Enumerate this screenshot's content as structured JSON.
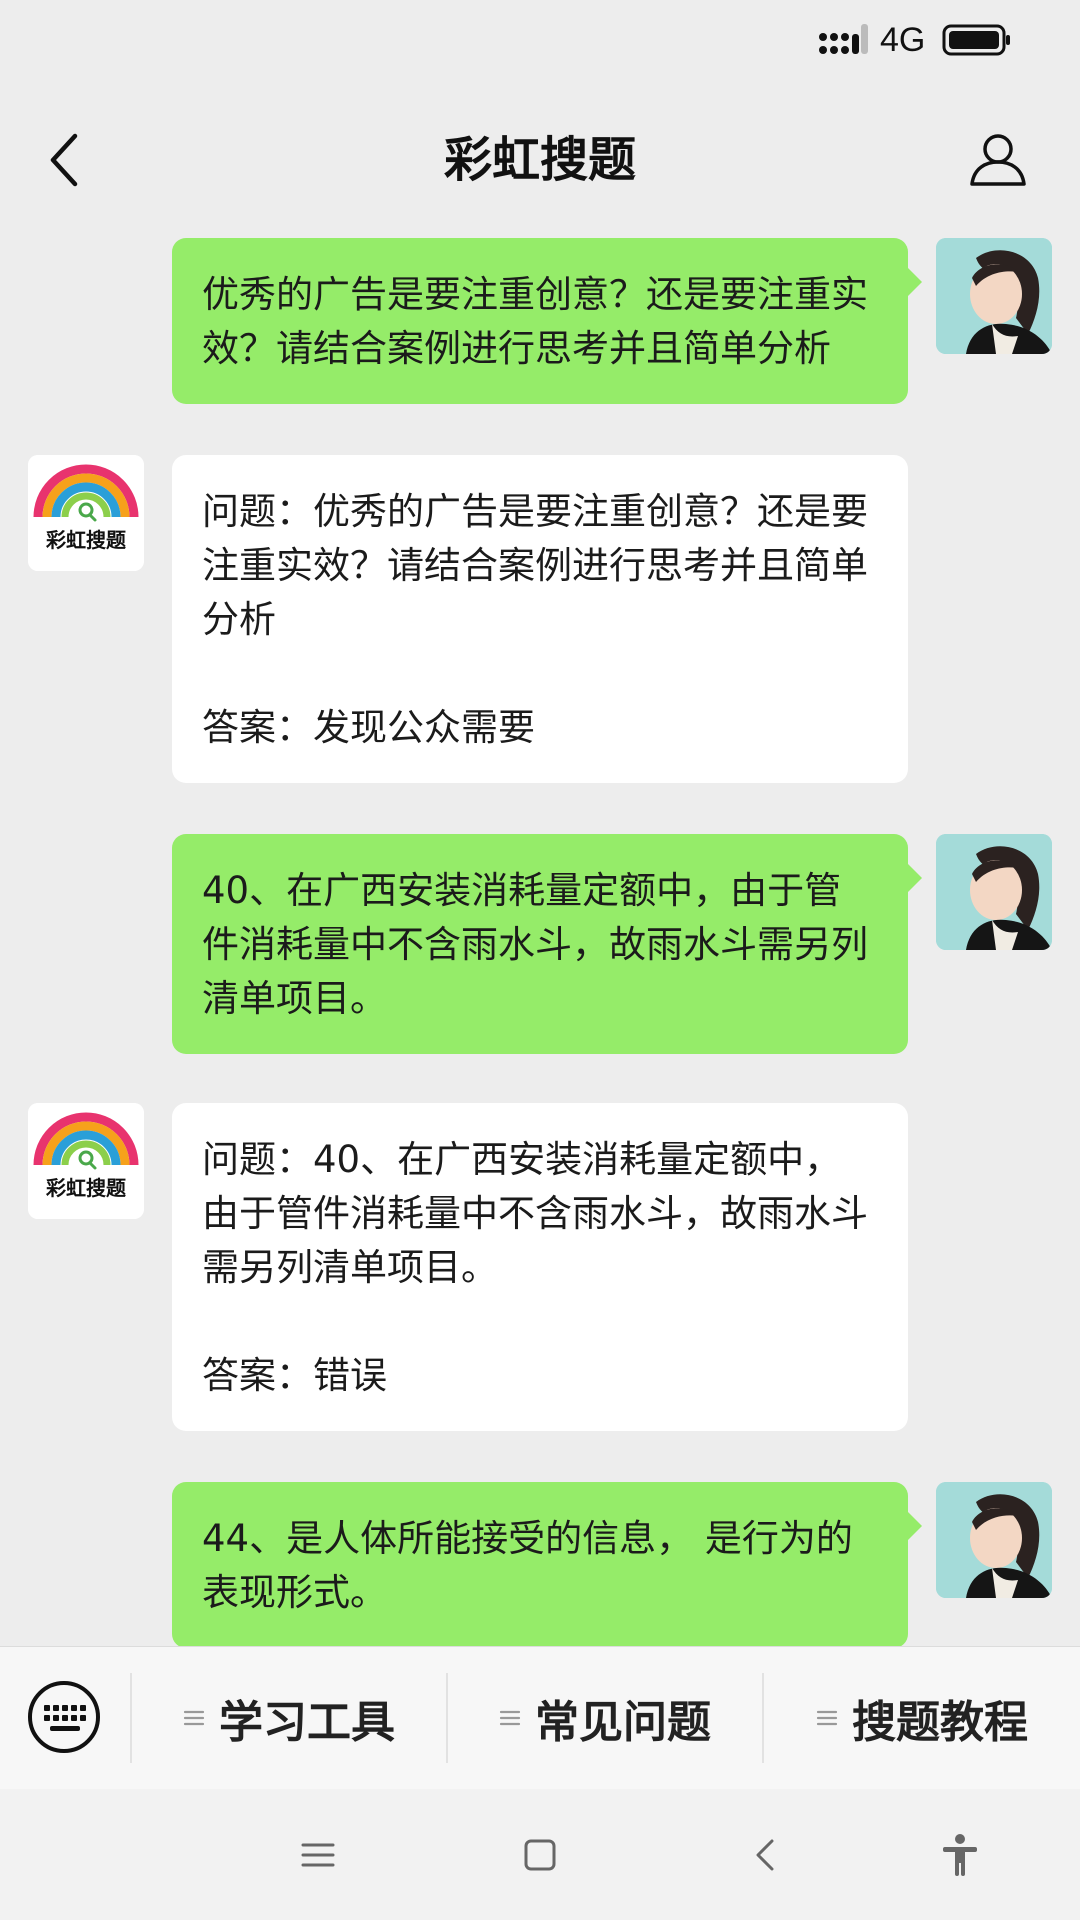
{
  "status_bar": {
    "network": "4G",
    "icons": [
      "signal-icon",
      "battery-icon"
    ]
  },
  "header": {
    "title": "彩虹搜题",
    "back_icon": "chevron-left-icon",
    "profile_icon": "person-icon"
  },
  "bot": {
    "avatar_text": "彩虹搜题"
  },
  "messages": [
    {
      "sender": "user",
      "text": "优秀的广告是要注重创意？还是要注重实效？请结合案例进行思考并且简单分析"
    },
    {
      "sender": "bot",
      "question": "问题：优秀的广告是要注重创意？还是要注重实效？请结合案例进行思考并且简单分析",
      "answer": "答案：发现公众需要"
    },
    {
      "sender": "user",
      "text": "40、在广西安装消耗量定额中，由于管件消耗量中不含雨水斗，故雨水斗需另列清单项目。"
    },
    {
      "sender": "bot",
      "question": "问题：40、在广西安装消耗量定额中，由于管件消耗量中不含雨水斗，故雨水斗需另列清单项目。",
      "answer": "答案：错误"
    },
    {
      "sender": "user",
      "text": "44、是人体所能接受的信息， 是行为的表现形式。"
    }
  ],
  "menu": {
    "keyboard_icon": "keyboard-icon",
    "items": [
      {
        "label": "学习工具"
      },
      {
        "label": "常见问题"
      },
      {
        "label": "搜题教程"
      }
    ]
  },
  "system_nav": {
    "icons": [
      "menu-icon",
      "home-icon",
      "back-icon",
      "accessibility-icon"
    ]
  },
  "colors": {
    "background": "#ededed",
    "user_bubble": "#95ec69",
    "bot_bubble": "#ffffff"
  }
}
